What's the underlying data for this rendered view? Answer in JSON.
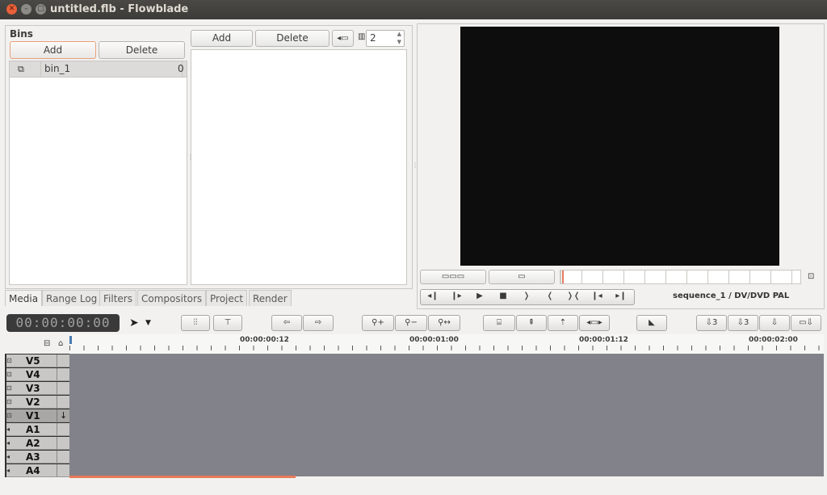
{
  "window": {
    "title": "untitled.flb - Flowblade"
  },
  "bins": {
    "heading": "Bins",
    "add_label": "Add",
    "delete_label": "Delete",
    "items": [
      {
        "name": "bin_1",
        "count": "0"
      }
    ]
  },
  "media": {
    "add_label": "Add",
    "delete_label": "Delete",
    "columns_value": "2"
  },
  "tabs": [
    {
      "label": "Media"
    },
    {
      "label": "Range Log"
    },
    {
      "label": "Filters"
    },
    {
      "label": "Compositors"
    },
    {
      "label": "Project"
    },
    {
      "label": "Render"
    }
  ],
  "monitor": {
    "sequence_info": "sequence_1 / DV/DVD PAL"
  },
  "timeline": {
    "timecode": "00:00:00:00",
    "ruler_labels": [
      "00:00:00:12",
      "00:00:01:00",
      "00:00:01:12",
      "00:00:02:00"
    ],
    "tracks": [
      {
        "name": "V5",
        "kind": "video"
      },
      {
        "name": "V4",
        "kind": "video"
      },
      {
        "name": "V3",
        "kind": "video"
      },
      {
        "name": "V2",
        "kind": "video"
      },
      {
        "name": "V1",
        "kind": "video"
      },
      {
        "name": "A1",
        "kind": "audio"
      },
      {
        "name": "A2",
        "kind": "audio"
      },
      {
        "name": "A3",
        "kind": "audio"
      },
      {
        "name": "A4",
        "kind": "audio"
      }
    ]
  },
  "colors": {
    "timeline_bg": "#82828a",
    "timecode_bg": "#3a3a3a",
    "timecode_fg": "#a0a0a0",
    "window_close": "#e9603b"
  }
}
